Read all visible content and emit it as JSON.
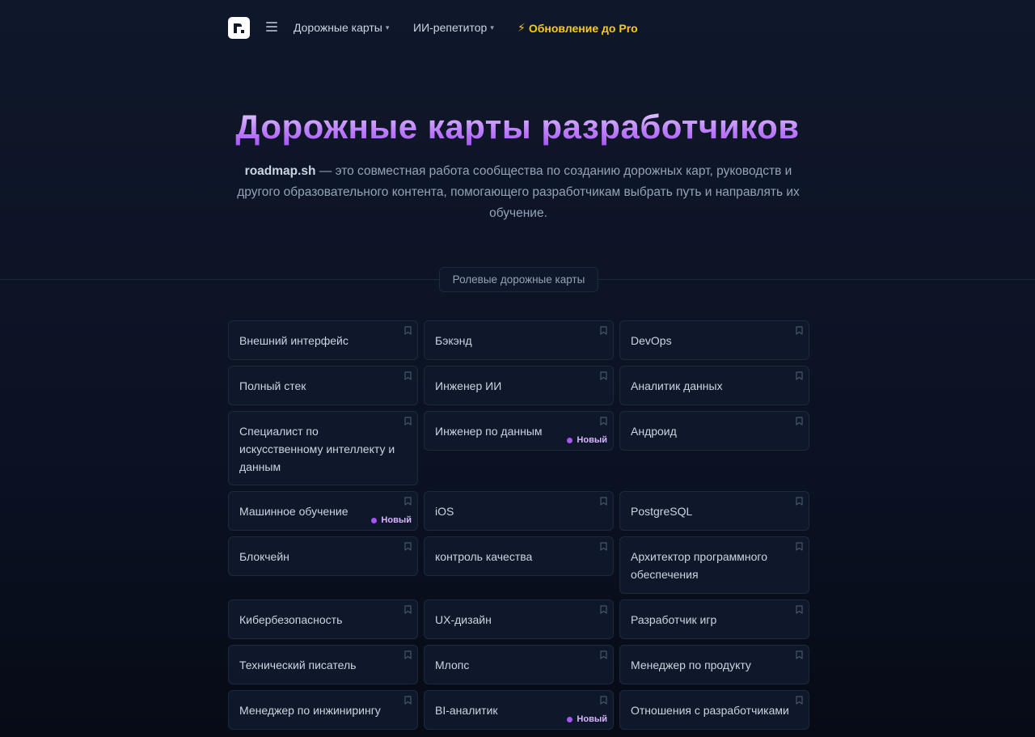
{
  "nav": {
    "roadmaps": "Дорожные карты",
    "ai_tutor": "ИИ-репетитор",
    "upgrade": "Обновление до Pro"
  },
  "hero": {
    "title": "Дорожные карты разработчиков",
    "brand": "roadmap.sh",
    "description": " — это совместная работа сообщества по созданию дорожных карт, руководств и другого образовательного контента, помогающего разработчикам выбрать путь и направлять их обучение."
  },
  "section": {
    "label": "Ролевые дорожные карты"
  },
  "badge_label": "Новый",
  "cards": [
    {
      "label": "Внешний интерфейс"
    },
    {
      "label": "Бэкэнд"
    },
    {
      "label": "DevOps"
    },
    {
      "label": "Полный стек"
    },
    {
      "label": "Инженер ИИ"
    },
    {
      "label": "Аналитик данных"
    },
    {
      "label": "Специалист по искусственному интеллекту и данным"
    },
    {
      "label": "Инженер по данным",
      "is_new": true
    },
    {
      "label": "Андроид"
    },
    {
      "label": "Машинное обучение",
      "is_new": true
    },
    {
      "label": "iOS"
    },
    {
      "label": "PostgreSQL"
    },
    {
      "label": "Блокчейн"
    },
    {
      "label": "контроль качества"
    },
    {
      "label": "Архитектор программного обеспечения"
    },
    {
      "label": "Кибербезопасность"
    },
    {
      "label": "UX-дизайн"
    },
    {
      "label": "Разработчик игр"
    },
    {
      "label": "Технический писатель"
    },
    {
      "label": "Млопс"
    },
    {
      "label": "Менеджер по продукту"
    },
    {
      "label": "Менеджер по инжинирингу"
    },
    {
      "label": "BI-аналитик",
      "is_new": true
    },
    {
      "label": "Отношения с разработчиками"
    }
  ],
  "colors": {
    "background": "#0f172a",
    "card_border": "#1e293b",
    "accent_purple": "#c084fc",
    "pro_yellow": "#facc15"
  }
}
